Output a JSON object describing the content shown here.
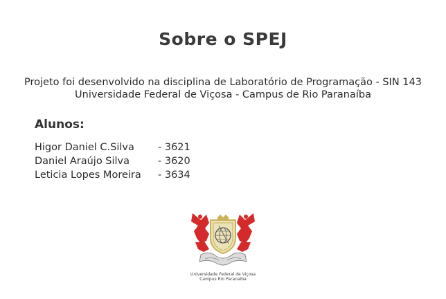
{
  "page": {
    "title": "Sobre o SPEJ",
    "description_line1": "Projeto foi desenvolvido na disciplina de Laboratório de Programação - SIN 143",
    "description_line2": "Universidade Federal de Viçosa - Campus de Rio Paranaíba"
  },
  "students": {
    "heading": "Alunos:",
    "items": [
      {
        "name": "Higor Daniel C.Silva",
        "id": "- 3621"
      },
      {
        "name": "Daniel Araújo Silva",
        "id": "- 3620"
      },
      {
        "name": "Leticia Lopes Moreira",
        "id": "- 3634"
      }
    ]
  },
  "logo": {
    "icon": "ufv-crest-icon",
    "caption_line1": "Universidade Federal de Viçosa",
    "caption_line2": "Campus Rio Paranaíba",
    "colors": {
      "red": "#d42a2a",
      "gold": "#c9b25a",
      "beige": "#ece2b8",
      "grey": "#8a8a8a"
    }
  }
}
